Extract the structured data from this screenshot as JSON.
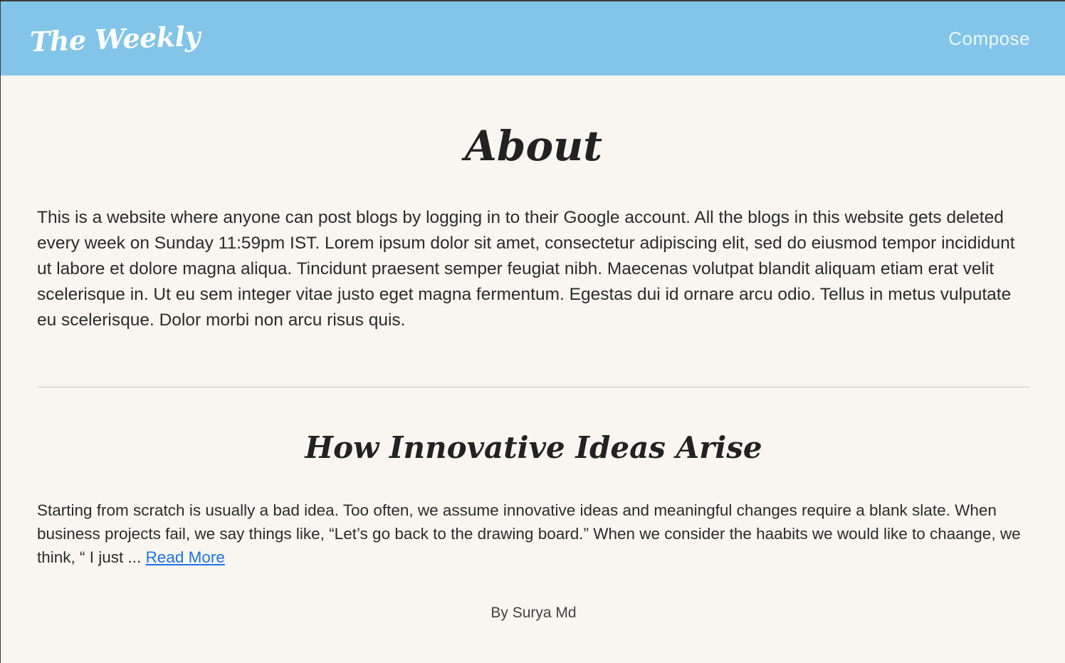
{
  "navbar": {
    "brand": "The Weekly",
    "compose_label": "Compose"
  },
  "about": {
    "title": "About",
    "text": "This is a website where anyone can post blogs by logging in to their Google account. All the blogs in this website gets deleted every week on Sunday 11:59pm IST. Lorem ipsum dolor sit amet, consectetur adipiscing elit, sed do eiusmod tempor incididunt ut labore et dolore magna aliqua. Tincidunt praesent semper feugiat nibh. Maecenas volutpat blandit aliquam etiam erat velit scelerisque in. Ut eu sem integer vitae justo eget magna fermentum. Egestas dui id ornare arcu odio. Tellus in metus vulputate eu scelerisque. Dolor morbi non arcu risus quis."
  },
  "posts": [
    {
      "title": "How Innovative Ideas Arise",
      "excerpt": "Starting from scratch is usually a bad idea. Too often, we assume innovative ideas and meaningful changes require a blank slate. When business projects fail, we say things like, “Let’s go back to the drawing board.” When we consider the haabits we would like to chaange, we think, “ I just ...",
      "read_more_label": "Read More",
      "author": "By Surya Md"
    }
  ],
  "colors": {
    "navbar_bg": "#82c5e8",
    "page_bg": "#f9f6f0",
    "link": "#1a73e8"
  }
}
